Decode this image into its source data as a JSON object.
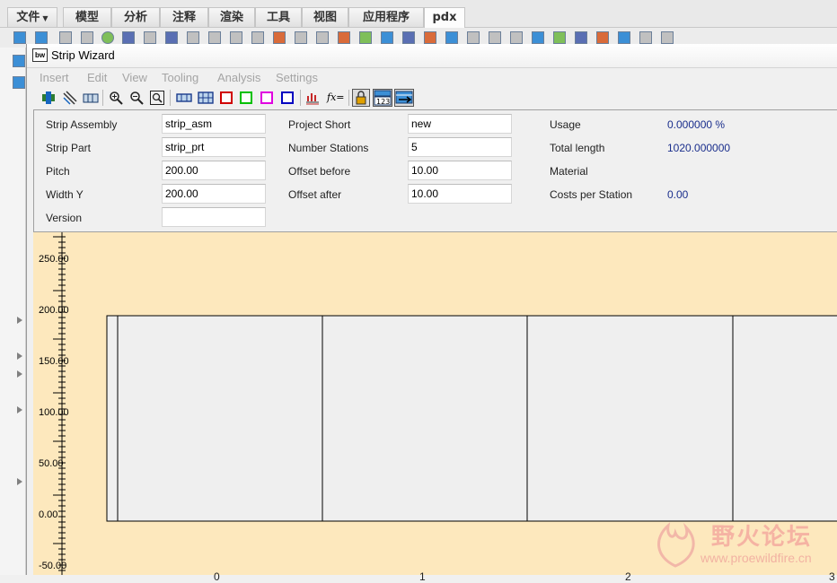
{
  "ribbon": {
    "tabs": [
      {
        "label": "文件"
      },
      {
        "label": "模型"
      },
      {
        "label": "分析"
      },
      {
        "label": "注释"
      },
      {
        "label": "渲染"
      },
      {
        "label": "工具"
      },
      {
        "label": "视图"
      },
      {
        "label": "应用程序"
      },
      {
        "label": "pdx"
      }
    ],
    "active_tab": "pdx"
  },
  "wizard": {
    "title": "Strip Wizard",
    "logo": "bw",
    "menu": [
      "Insert",
      "Edit",
      "View",
      "Tooling",
      "Analysis",
      "Settings"
    ],
    "toolbar": {
      "fx_label": "fx=",
      "numbering_label": "123",
      "icons": [
        "strip-insert-icon",
        "hatch-icon",
        "station-icon",
        "zoom-in-icon",
        "zoom-out-icon",
        "zoom-fit-icon",
        "view-strip-icon",
        "view-grid-icon",
        "red-square-icon",
        "green-square-icon",
        "magenta-square-icon",
        "blue-square-icon",
        "cost-chart-icon",
        "formula-icon",
        "lock-icon",
        "numbering-icon",
        "export-icon"
      ]
    },
    "form": {
      "strip_assembly": {
        "label": "Strip Assembly",
        "value": "strip_asm"
      },
      "strip_part": {
        "label": "Strip Part",
        "value": "strip_prt"
      },
      "pitch": {
        "label": "Pitch",
        "value": "200.00"
      },
      "width_y": {
        "label": "Width Y",
        "value": "200.00"
      },
      "version": {
        "label": "Version",
        "value": ""
      },
      "project_short": {
        "label": "Project Short",
        "value": "new"
      },
      "number_stations": {
        "label": "Number Stations",
        "value": "5"
      },
      "offset_before": {
        "label": "Offset before",
        "value": "10.00"
      },
      "offset_after": {
        "label": "Offset after",
        "value": "10.00"
      },
      "usage": {
        "label": "Usage",
        "value": "0.000000 %"
      },
      "total_length": {
        "label": "Total length",
        "value": "1020.000000"
      },
      "material": {
        "label": "Material",
        "value": ""
      },
      "costs_per_station": {
        "label": "Costs per Station",
        "value": "0.00"
      }
    },
    "canvas": {
      "y_ticks": [
        "250.00",
        "200.00",
        "150.00",
        "100.00",
        "50.00",
        "0.00",
        "-50.00"
      ],
      "station_labels": [
        "0",
        "1",
        "2",
        "3"
      ],
      "background_color": "#fde8bd"
    }
  },
  "watermark": {
    "text_cn": "野火论坛",
    "url": "www.proewildfire.cn"
  }
}
